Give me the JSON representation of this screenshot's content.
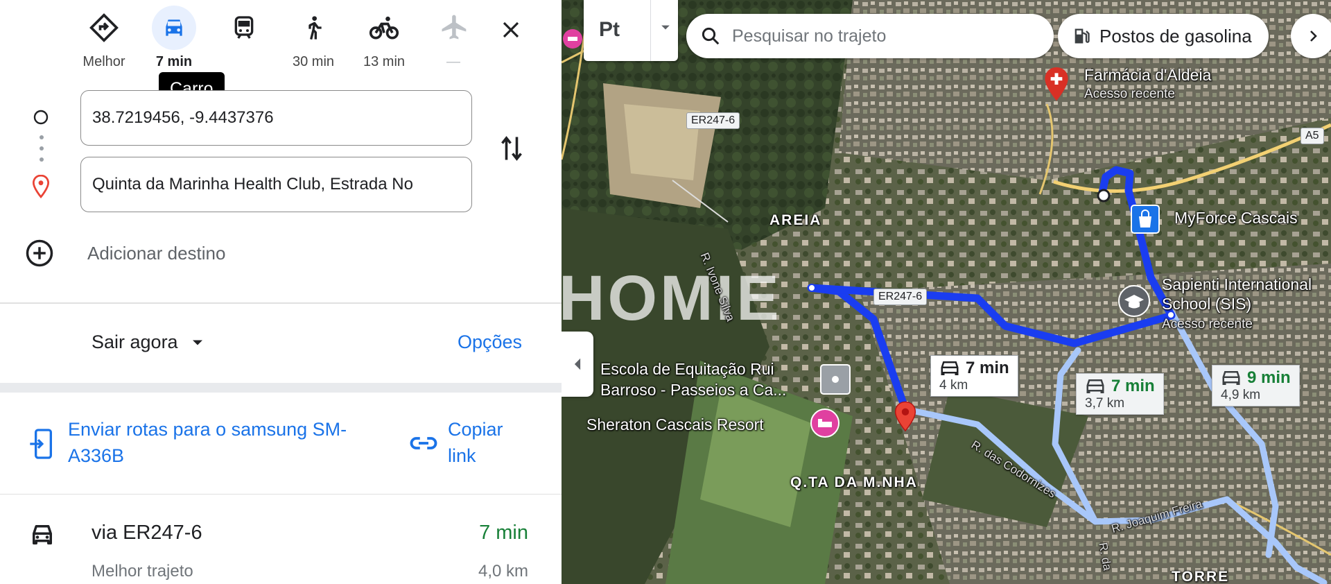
{
  "travel_modes": [
    {
      "name": "best",
      "label": "Melhor",
      "active": false
    },
    {
      "name": "car",
      "label": "7 min",
      "active": true
    },
    {
      "name": "transit",
      "label": "",
      "active": false
    },
    {
      "name": "walk",
      "label": "30 min",
      "active": false
    },
    {
      "name": "bike",
      "label": "13 min",
      "active": false
    },
    {
      "name": "flight",
      "label": "—",
      "active": false
    }
  ],
  "tooltip": "Carro",
  "origin": {
    "value": "38.7219456, -9.4437376"
  },
  "destination": {
    "value": "Quinta da Marinha Health Club, Estrada No"
  },
  "add_destination": "Adicionar destino",
  "depart": {
    "label": "Sair agora"
  },
  "options_label": "Opções",
  "send_routes": "Enviar rotas para o samsung SM-A336B",
  "copy_link": "Copiar link",
  "route": {
    "via": "via ER247-6",
    "time": "7 min",
    "subtitle": "Melhor trajeto",
    "distance": "4,0 km"
  },
  "map": {
    "layer_label": "Pt",
    "search_placeholder": "Pesquisar no trajeto",
    "chip_gas": "Postos de gasolina",
    "watermark": "HOMIE",
    "places": {
      "farmacia": "Farmácia d'Aldeia",
      "farmacia_sub": "Acesso recente",
      "myforce": "MyForce Cascais",
      "sapienti_1": "Sapienti International",
      "sapienti_2": "School (SIS)",
      "sapienti_sub": "Acesso recente",
      "escola_1": "Escola de Equitação Rui",
      "escola_2": "Barroso - Passeios a Ca...",
      "sheraton": "Sheraton Cascais Resort"
    },
    "areas": {
      "areia": "AREIA",
      "quinta": "Q.TA DA M.NHA",
      "torre": "TORRE"
    },
    "streets": {
      "ivone": "R. Ivone Silva",
      "codornizes": "R. das Codornizes",
      "joaquim": "R. Joaquim Freira",
      "da": "R. da"
    },
    "shields": {
      "top": "ER247-6",
      "mid": "ER247-6",
      "a5": "A5"
    },
    "callouts": [
      {
        "time": "7 min",
        "distance": "4 km"
      },
      {
        "time": "7 min",
        "distance": "3,7 km"
      },
      {
        "time": "9 min",
        "distance": "4,9 km"
      }
    ]
  },
  "colors": {
    "accent": "#1a73e8",
    "route_primary": "#1a3df0",
    "route_alt": "#a8c7fa",
    "time_green": "#188038"
  }
}
